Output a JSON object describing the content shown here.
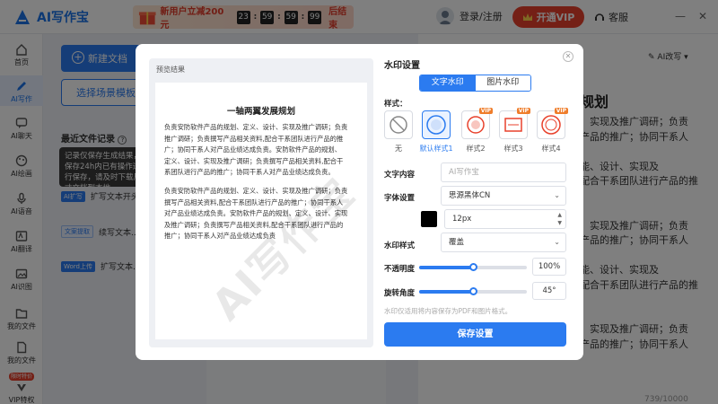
{
  "app": {
    "title": "AI写作宝"
  },
  "promo": {
    "text": "新用户立减200元",
    "countdown": [
      "23",
      "59",
      "59",
      "99"
    ],
    "end_text": "后结束"
  },
  "header": {
    "login": "登录/注册",
    "vip": "开通VIP",
    "service": "客服",
    "minimize": "—",
    "close": "✕"
  },
  "sidebar": {
    "items": [
      {
        "label": "首页",
        "icon": "home-icon"
      },
      {
        "label": "AI写作",
        "icon": "pen-icon"
      },
      {
        "label": "AI聊天",
        "icon": "chat-icon"
      },
      {
        "label": "AI绘画",
        "icon": "paint-icon"
      },
      {
        "label": "AI语音",
        "icon": "voice-icon"
      },
      {
        "label": "AI翻译",
        "icon": "translate-icon"
      },
      {
        "label": "AI识图",
        "icon": "image-icon"
      },
      {
        "label": "我的文件",
        "icon": "folder-icon"
      },
      {
        "label": "我的文件",
        "icon": "file-icon"
      },
      {
        "label": "VIP特权",
        "icon": "vip-icon",
        "badge": "限时特价"
      }
    ]
  },
  "left": {
    "new_doc": "新建文档",
    "scene": "选择场景模板",
    "recent_title": "最近文件记录",
    "tip": "记录仅保存生成结果，保存24h内已有操作进行保存，请及时下载尺寸文档到本地",
    "items": [
      {
        "tag": "AI扩写",
        "text": "扩写文本开头..."
      },
      {
        "tag": "文案提取",
        "text": "续写文本..."
      },
      {
        "tag": "Word上传",
        "text": "扩写文本..."
      }
    ]
  },
  "editor": {
    "rewrite": "AI改写",
    "title": "规划",
    "text": "、实现及推广调研；负责\n产品的推广；协同干系人\n\n能、设计、实现及\n配合干系团队进行产品的推\n\n\n、实现及推广调研；负责\n产品的推广；协同干系人\n\n能、设计、实现及\n配合干系团队进行产品的推\n\n\n、实现及推广调研；负责\n产品的推广；协同干系人",
    "counter": "739/10000"
  },
  "dialog": {
    "preview_label": "预览结果",
    "doc_title": "一轴两翼发展规划",
    "doc_p1": "负责安防软件产品的规划、定义、设计、实现及推广调研；负责\n推广调研；负责撰写产品相关资料,配合干系团队进行产品的推\n广；协同干系人对产品业绩达成负责。安防软件产品的规划、\n定义、设计、实现及推广调研；负责撰写产品相关资料,配合干\n系团队进行产品的推广；协同干系人对产品业绩达成负责。",
    "doc_p2": "负责安防软件产品的规划、定义、设计、实现及推广调研；负责\n撰写产品相关资料,配合干系团队进行产品的推广；协同干系人\n对产品业绩达成负责。安防软件产品的规划、定义、设计、实现\n及推广调研；负责撰写产品相关资料,配合干系团队进行产品的\n推广；协同干系人对产品业绩达成负责",
    "watermark_sample": "AI写作宝",
    "settings_title": "水印设置",
    "tabs": [
      {
        "label": "文字水印",
        "active": true
      },
      {
        "label": "图片水印",
        "active": false
      }
    ],
    "style_label": "样式：",
    "styles": [
      {
        "label": "无",
        "vip": false
      },
      {
        "label": "默认样式1",
        "vip": false,
        "selected": true
      },
      {
        "label": "样式2",
        "vip": true
      },
      {
        "label": "样式3",
        "vip": true
      },
      {
        "label": "样式4",
        "vip": true
      }
    ],
    "vip_tag": "VIP",
    "text_label": "文字内容",
    "text_placeholder": "AI写作宝",
    "font_label": "字体设置",
    "font_value": "思源黑体CN",
    "color": "#000000",
    "size_value": "12px",
    "wm_style_label": "水印样式",
    "wm_style_value": "覆盖",
    "opacity_label": "不透明度",
    "opacity_value": "100%",
    "opacity_fraction": 0.5,
    "rotate_label": "旋转角度",
    "rotate_value": "45°",
    "rotate_fraction": 0.5,
    "note": "水印仅适用将内容保存为PDF和图片格式。",
    "save": "保存设置"
  },
  "colors": {
    "accent": "#2b7bf0",
    "vip": "#e8412c",
    "promo": "#e23b2a"
  }
}
